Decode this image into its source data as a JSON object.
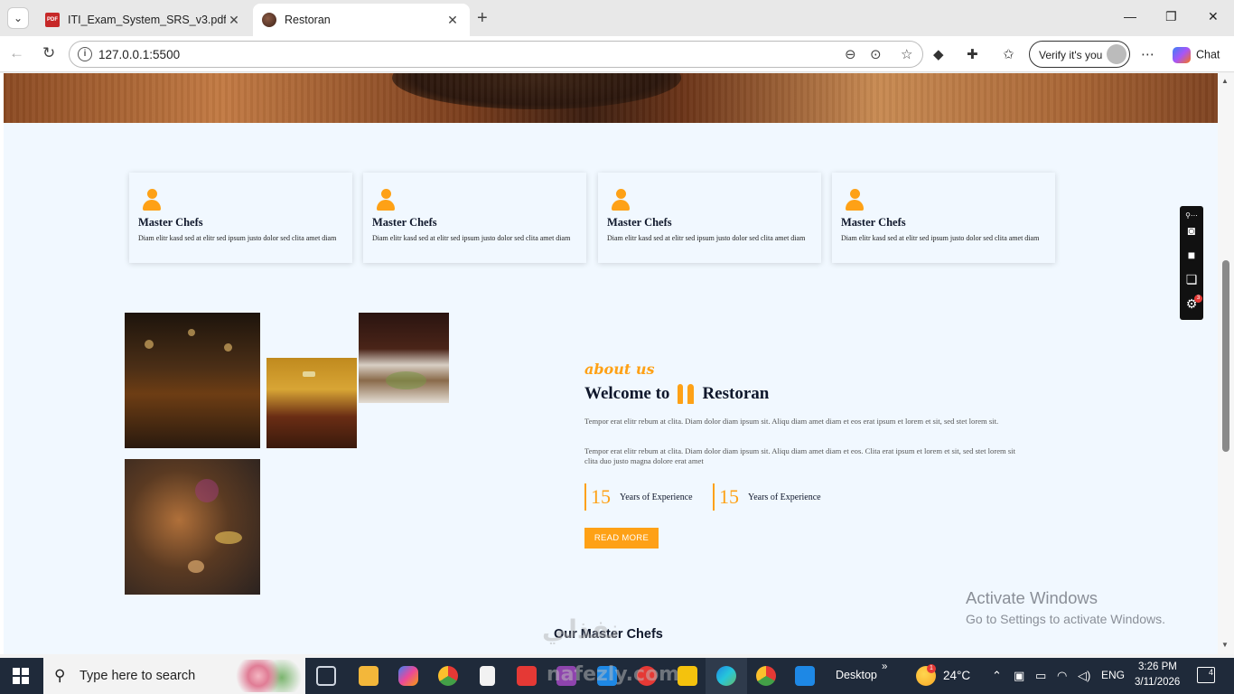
{
  "browser": {
    "tabs": [
      {
        "label": "ITI_Exam_System_SRS_v3.pdf",
        "icon": "pdf-icon"
      },
      {
        "label": "Restoran",
        "icon": "site-icon"
      }
    ],
    "url": "127.0.0.1:5500",
    "verify_label": "Verify it's you",
    "chat_label": "Chat"
  },
  "page": {
    "chef_cards": [
      {
        "title": "Master Chefs",
        "desc": "Diam elitr kasd sed at elitr sed ipsum justo dolor sed clita amet diam"
      },
      {
        "title": "Master Chefs",
        "desc": "Diam elitr kasd sed at elitr sed ipsum justo dolor sed clita amet diam"
      },
      {
        "title": "Master Chefs",
        "desc": "Diam elitr kasd sed at elitr sed ipsum justo dolor sed clita amet diam"
      },
      {
        "title": "Master Chefs",
        "desc": "Diam elitr kasd sed at elitr sed ipsum justo dolor sed clita amet diam"
      }
    ],
    "about": {
      "subtitle": "about us",
      "title_prefix": "Welcome to",
      "title_brand": "Restoran",
      "para1": "Tempor erat elitr rebum at clita. Diam dolor diam ipsum sit. Aliqu diam amet diam et eos erat ipsum et lorem et sit, sed stet lorem sit.",
      "para2": "Tempor erat elitr rebum at clita. Diam dolor diam ipsum sit. Aliqu diam amet diam et eos. Clita erat ipsum et lorem et sit, sed stet lorem sit clita duo justo magna dolore erat amet",
      "stats": [
        {
          "number": "15",
          "label": "Years of Experience"
        },
        {
          "number": "15",
          "label": "Years of Experience"
        }
      ],
      "read_more": "READ MORE"
    },
    "next_section_title": "Our Master Chefs",
    "brand_color": "#fea116",
    "dark_color": "#0f172b"
  },
  "windows": {
    "activate_title": "Activate Windows",
    "activate_sub": "Go to Settings to activate Windows."
  },
  "taskbar": {
    "search_placeholder": "Type here to search",
    "desktop_label": "Desktop",
    "weather_temp": "24°C",
    "weather_badge": "1",
    "language": "ENG",
    "time": "3:26 PM",
    "date": "3/11/2026",
    "notification_count": "4"
  },
  "watermark": {
    "arabic": "نفذلي",
    "latin": "nafezly.com"
  }
}
